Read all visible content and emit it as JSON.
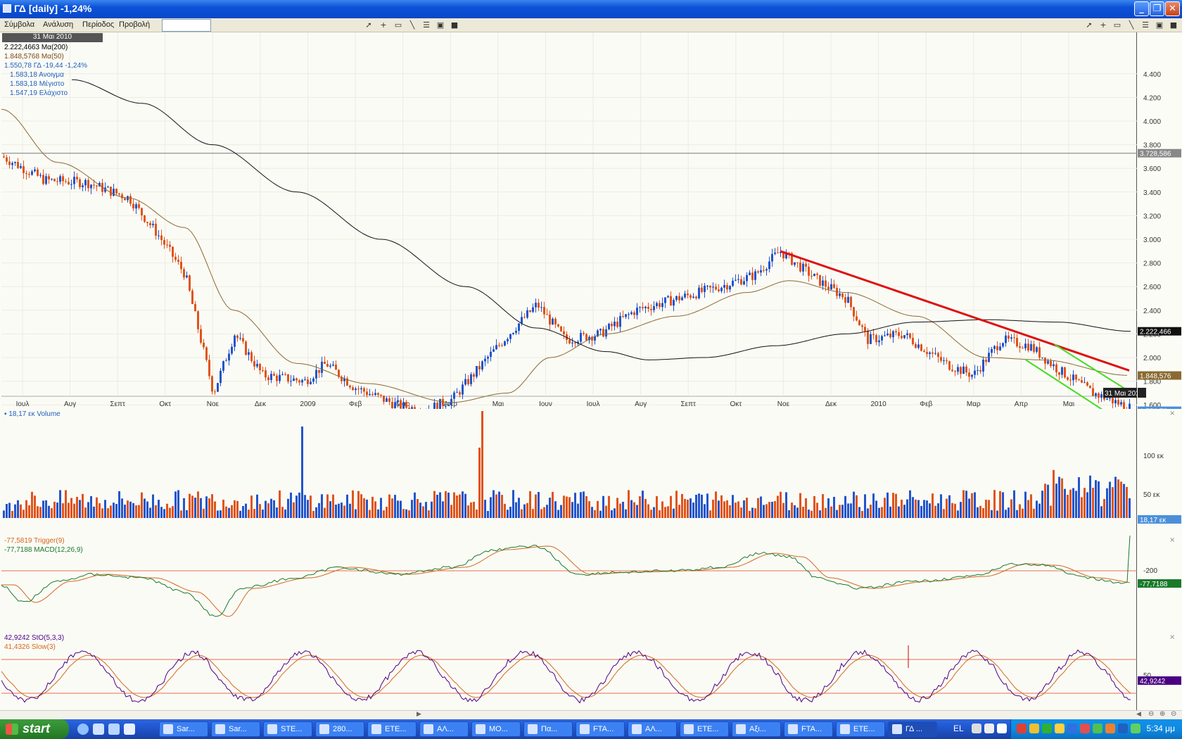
{
  "window": {
    "title": "ΓΔ [daily] -1,24%"
  },
  "menu": {
    "items": [
      "Σύμβολα",
      "Ανάλυση",
      "Περίοδος",
      "Προβολή"
    ],
    "symbol_value": ""
  },
  "price_panel": {
    "date_header": "31 Μαι 2010",
    "legend": [
      {
        "text": "2.222,4663 Μα(200)",
        "color": "#000000"
      },
      {
        "text": "1.848,5768 Μα(50)",
        "color": "#7a4a10"
      },
      {
        "text": "1.550,78 ΓΔ -19,44 -1,24%",
        "color": "#1f5fbf",
        "change_color": "#d04010"
      },
      {
        "text": "1.583,18 Ανοιγμα",
        "color": "#1f5fbf"
      },
      {
        "text": "1.583,18 Μέγιστο",
        "color": "#1f5fbf"
      },
      {
        "text": "1.547,19 Ελάχιστο",
        "color": "#1f5fbf"
      }
    ],
    "y_ticks": [
      "4.400",
      "4.200",
      "4.000",
      "3.800",
      "3.600",
      "3.400",
      "3.200",
      "3.000",
      "2.800",
      "2.600",
      "2.400",
      "2.200",
      "2.000",
      "1.800",
      "1.600"
    ],
    "x_ticks": [
      "Ιουλ",
      "Αυγ",
      "Σεπτ",
      "Οκτ",
      "Νοε",
      "Δεκ",
      "2009",
      "Φεβ",
      "Μαρ",
      "Απρ",
      "Μαι",
      "Ιουν",
      "Ιουλ",
      "Αυγ",
      "Σεπτ",
      "Οκτ",
      "Νοε",
      "Δεκ",
      "2010",
      "Φεβ",
      "Μαρ",
      "Απρ",
      "Μαι"
    ],
    "markers": {
      "hline": "3.728,586",
      "ma200": "2.222,466",
      "ma50": "1.848,576",
      "last": "1.550,78",
      "date": "31 Μαι 2010"
    },
    "colors": {
      "up": "#2255cc",
      "down": "#e0541a",
      "ma200": "#111111",
      "ma50": "#8a6a30",
      "trend_red": "#dd1111",
      "trend_green": "#44dd22"
    }
  },
  "volume_panel": {
    "legend": "18,17 εκ Volume",
    "ticks": [
      "100 εκ",
      "50 εκ"
    ],
    "last": "18,17 εκ"
  },
  "macd_panel": {
    "legend": [
      {
        "text": "-77,5819 Trigger(9)",
        "color": "#d2691e"
      },
      {
        "text": "-77,7188 MACD(12,26,9)",
        "color": "#1a7a2a"
      }
    ],
    "ticks": [
      "-200"
    ],
    "last": "-77,7188"
  },
  "stoch_panel": {
    "legend": [
      {
        "text": "42,9242 StO(5,3,3)",
        "color": "#4b0082"
      },
      {
        "text": "41,4326 Slow(3)",
        "color": "#d2691e"
      }
    ],
    "ticks": [
      "50"
    ],
    "last": "42,9242"
  },
  "taskbar": {
    "start": "start",
    "tasks": [
      "Sar...",
      "Sar...",
      "STE...",
      "280...",
      "ETE...",
      "ΑΛ...",
      "ΜΟ...",
      "Πα...",
      "FTA...",
      "ΑΛ...",
      "ΕΤΕ...",
      "Αξι...",
      "FTA...",
      "ΕΤΕ...",
      "ΓΔ ..."
    ],
    "lang": "EL",
    "clock": "5:34 μμ"
  }
}
